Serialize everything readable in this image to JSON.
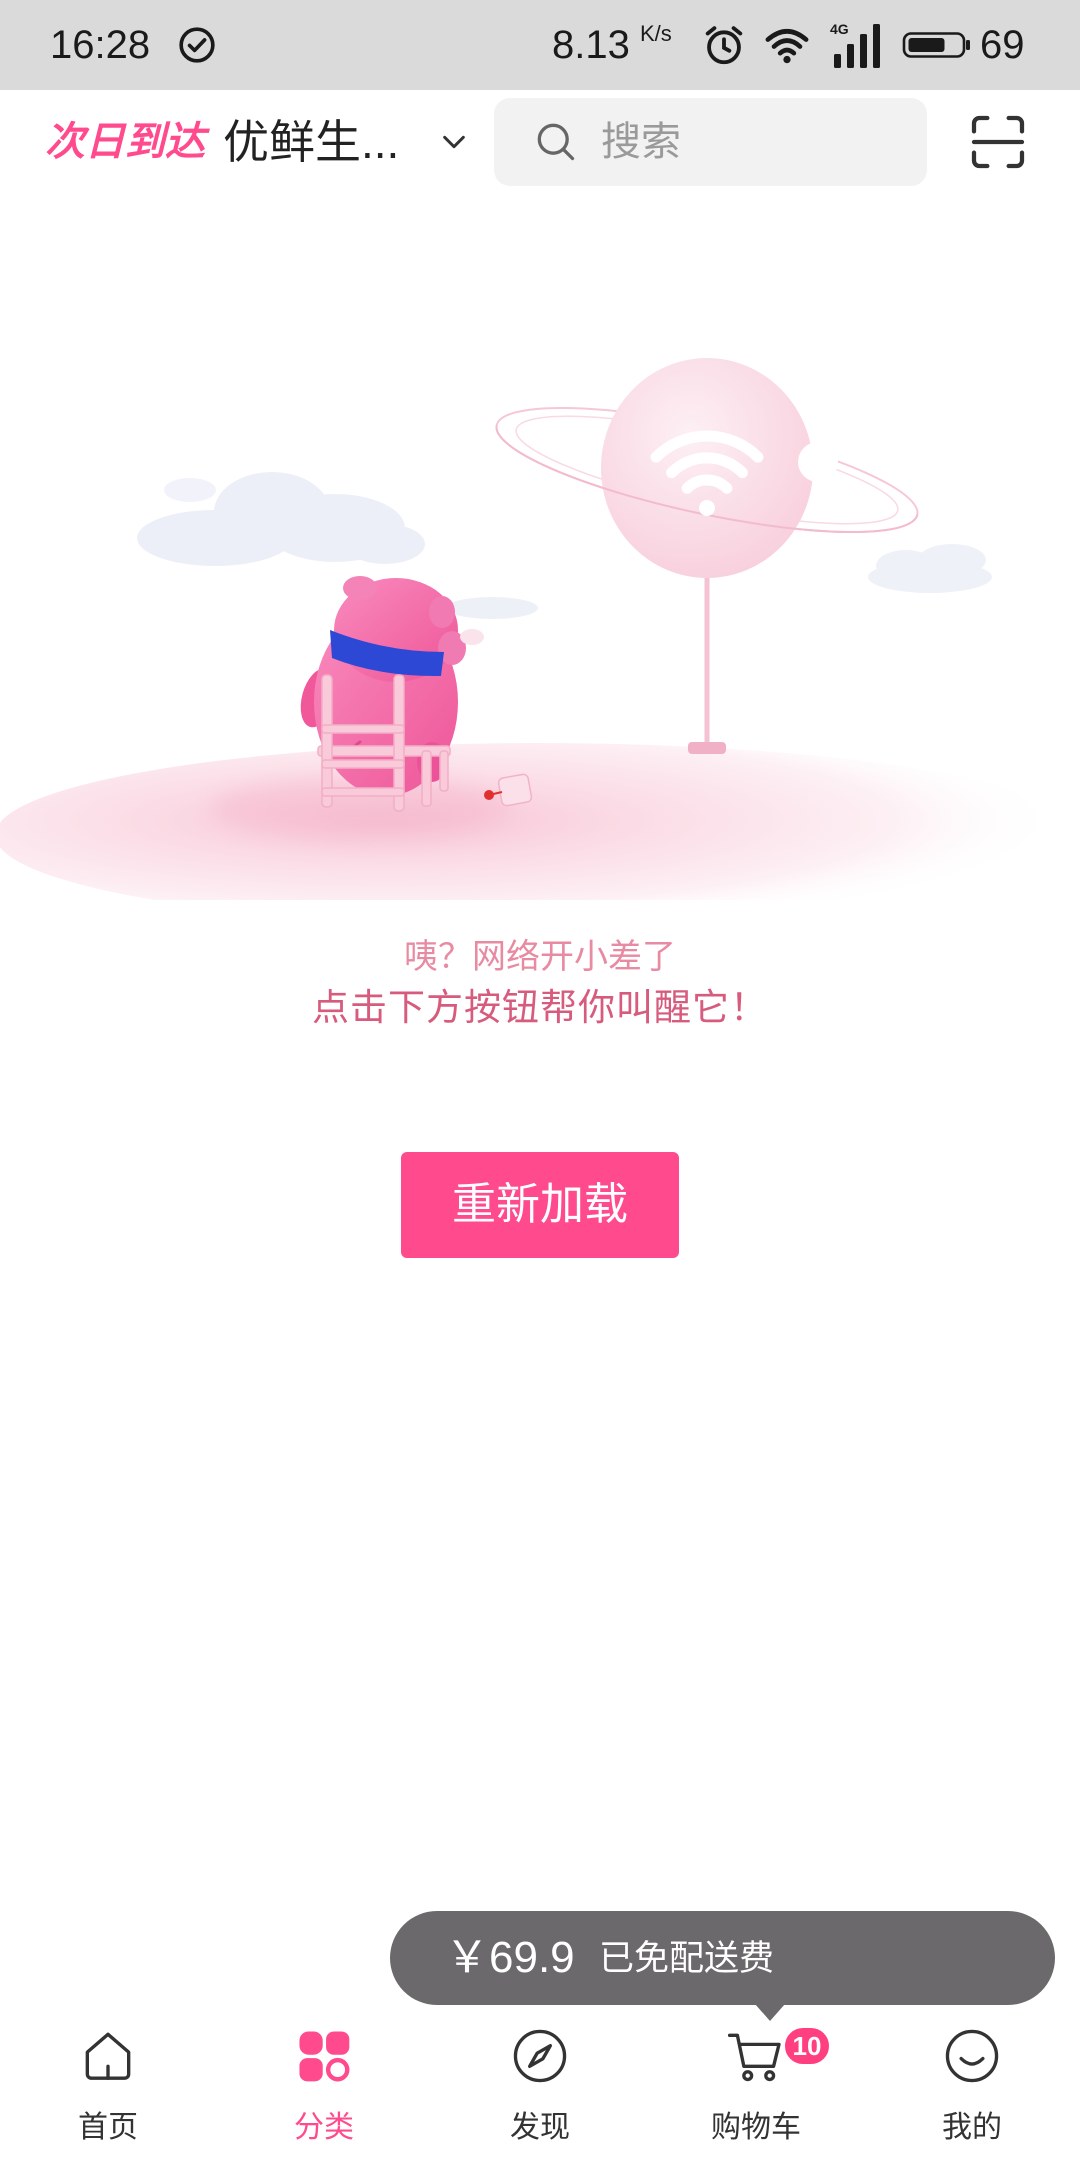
{
  "status_bar": {
    "time": "16:28",
    "network_speed": "8.13",
    "speed_unit": "K/s",
    "network_type": "4G",
    "battery_percent": "69",
    "icons": [
      "check-circle-icon",
      "alarm-icon",
      "wifi-icon",
      "signal-icon",
      "battery-icon"
    ]
  },
  "header": {
    "logo_text": "次日到达",
    "store_name": "优鲜生...",
    "dropdown_icon": "chevron-down-icon",
    "search_icon": "search-icon",
    "search_placeholder": "搜索",
    "scan_icon": "scan-icon"
  },
  "error_state": {
    "message_line1": "咦？网络开小差了",
    "message_line2": "点击下方按钮帮你叫醒它！",
    "reload_button": "重新加载"
  },
  "cart_tooltip": {
    "price": "￥69.9",
    "note": "已免配送费"
  },
  "nav": {
    "items": [
      {
        "label": "首页",
        "icon": "home-icon",
        "active": false
      },
      {
        "label": "分类",
        "icon": "category-icon",
        "active": true
      },
      {
        "label": "发现",
        "icon": "compass-icon",
        "active": false
      },
      {
        "label": "购物车",
        "icon": "cart-icon",
        "active": false,
        "badge": "10"
      },
      {
        "label": "我的",
        "icon": "profile-smile-icon",
        "active": false
      }
    ]
  },
  "colors": {
    "accent": "#ff4a8d",
    "tooltip_bg": "#6b696b",
    "status_bar_bg": "#dadada",
    "scarf_blue": "#2e48d6"
  }
}
